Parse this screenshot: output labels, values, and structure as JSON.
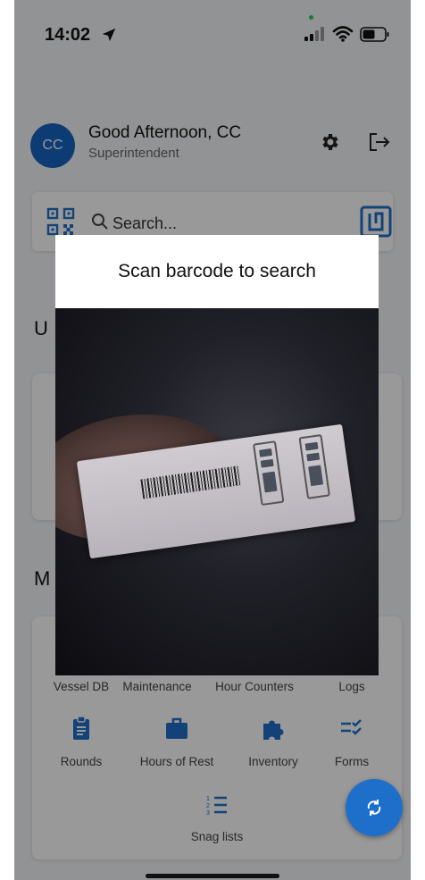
{
  "status_bar": {
    "time": "14:02"
  },
  "header": {
    "avatar_initials": "CC",
    "greeting": "Good Afternoon, CC",
    "role": "Superintendent"
  },
  "search": {
    "placeholder": "Search..."
  },
  "sections": {
    "upcoming_initial": "U",
    "modules_initial": "M"
  },
  "modules_row1": [
    "Vessel DB",
    "Maintenance",
    "Hour Counters",
    "Logs"
  ],
  "modules_row2": [
    "Rounds",
    "Hours of Rest",
    "Inventory",
    "Forms"
  ],
  "modules_row3": [
    "Snag lists"
  ],
  "dialog": {
    "title": "Scan barcode to search"
  },
  "colors": {
    "accent": "#1e6fc9",
    "avatar": "#1565c0"
  }
}
